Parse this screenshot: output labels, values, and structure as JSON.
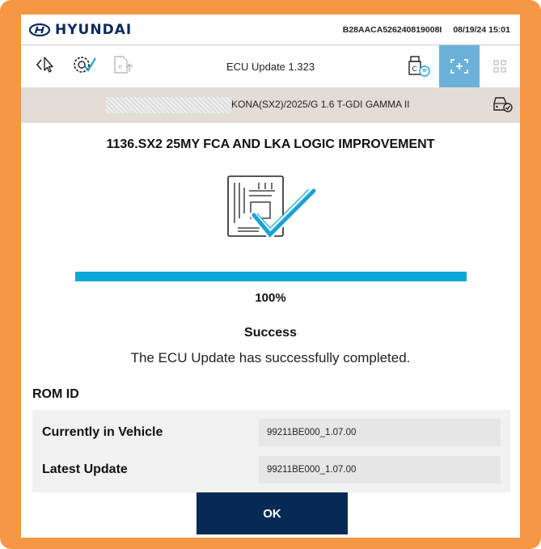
{
  "header": {
    "brand": "HYUNDAI",
    "serial": "B28AACA526240819008I",
    "datetime": "08/19/24 15:01"
  },
  "toolbar": {
    "title": "ECU Update 1.323",
    "icons": [
      "back-cursor-icon",
      "settings-check-icon",
      "document-upload-icon",
      "vci-wifi-icon",
      "focus-add-icon",
      "grid-icon"
    ]
  },
  "vehicle": {
    "description": "KONA(SX2)/2025/G 1.6 T-GDI GAMMA II"
  },
  "update": {
    "title": "1136.SX2 25MY FCA AND LKA LOGIC IMPROVEMENT",
    "progress_percent": 100,
    "progress_label": "100%",
    "status": "Success",
    "message": "The ECU Update has successfully completed."
  },
  "rom": {
    "heading": "ROM ID",
    "rows": [
      {
        "label": "Currently in Vehicle",
        "value": "99211BE000_1.07.00"
      },
      {
        "label": "Latest Update",
        "value": "99211BE000_1.07.00"
      }
    ]
  },
  "actions": {
    "ok_label": "OK"
  },
  "colors": {
    "frame": "#f59745",
    "brand": "#0b2a5a",
    "progress": "#0aa8d6",
    "active_tool": "#6cb1d9",
    "ok_button": "#072a55"
  }
}
